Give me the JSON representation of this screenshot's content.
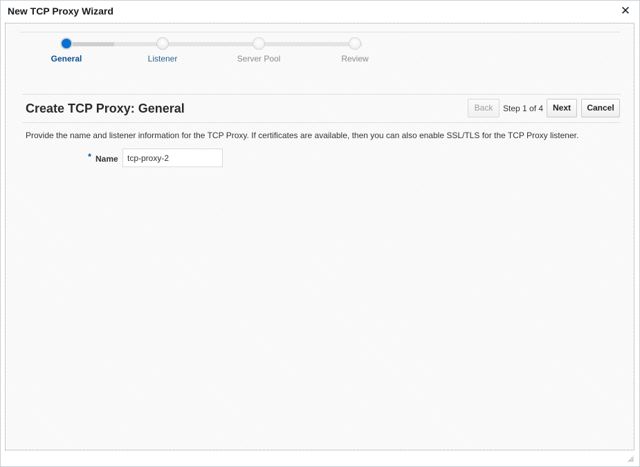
{
  "window": {
    "title": "New TCP Proxy Wizard",
    "close_symbol": "✕"
  },
  "train": {
    "steps": [
      {
        "label": "General",
        "state": "active"
      },
      {
        "label": "Listener",
        "state": "visited"
      },
      {
        "label": "Server Pool",
        "state": "unvisited"
      },
      {
        "label": "Review",
        "state": "unvisited"
      }
    ]
  },
  "page": {
    "title": "Create TCP Proxy: General",
    "description": "Provide the name and listener information for the TCP Proxy. If certificates are available, then you can also enable SSL/TLS for the TCP Proxy listener."
  },
  "nav": {
    "back_label": "Back",
    "step_text": "Step 1 of 4",
    "next_label": "Next",
    "cancel_label": "Cancel"
  },
  "form": {
    "required_marker": "*",
    "name_label": "Name",
    "name_value": "tcp-proxy-2"
  },
  "colors": {
    "accent": "#0b71d0",
    "active_label": "#0a4f8f"
  }
}
